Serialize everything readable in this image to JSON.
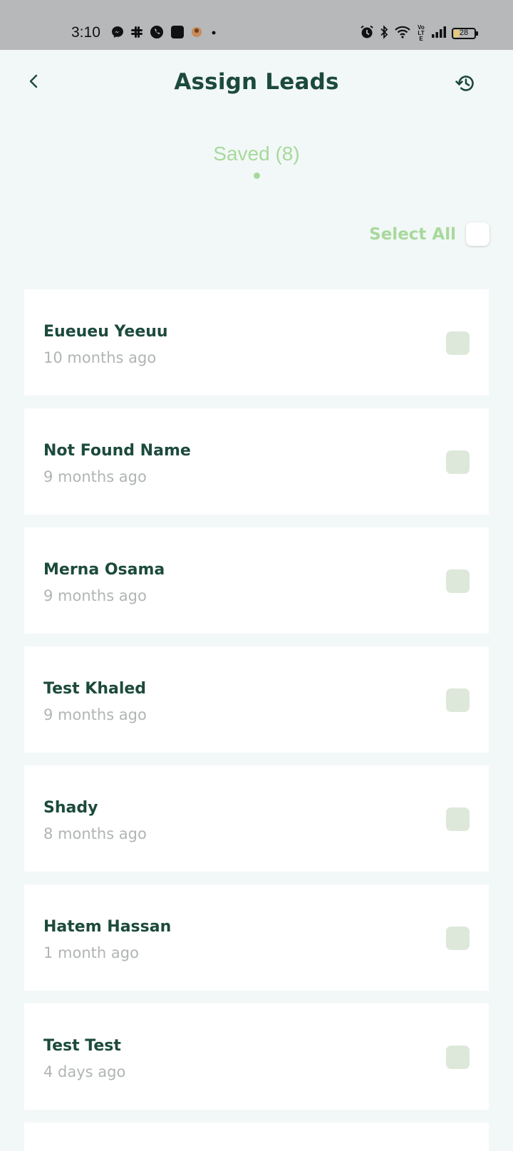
{
  "status_bar": {
    "time": "3:10",
    "battery_level": "28",
    "battery_fraction": 0.28,
    "lte_label": "Vo LTE",
    "left_icons": [
      "messenger-icon",
      "slack-icon",
      "whatsapp-icon",
      "square-app-icon",
      "avatar-icon",
      "dot-icon"
    ],
    "right_icons": [
      "alarm-icon",
      "bluetooth-icon",
      "wifi-icon",
      "volte-icon",
      "signal-icon",
      "battery-icon"
    ]
  },
  "header": {
    "title": "Assign Leads",
    "back_icon": "chevron-left-icon",
    "history_icon": "history-icon"
  },
  "tabs": [
    {
      "label": "Saved (8)",
      "active": true
    }
  ],
  "select_all": {
    "label": "Select All",
    "checked": false
  },
  "leads": [
    {
      "name": "Eueueu Yeeuu",
      "time": "10 months ago",
      "checked": false
    },
    {
      "name": "Not Found Name",
      "time": "9 months ago",
      "checked": false
    },
    {
      "name": "Merna Osama",
      "time": "9 months ago",
      "checked": false
    },
    {
      "name": "Test Khaled",
      "time": "9 months ago",
      "checked": false
    },
    {
      "name": "Shady",
      "time": "8 months ago",
      "checked": false
    },
    {
      "name": "Hatem Hassan",
      "time": "1 month ago",
      "checked": false
    },
    {
      "name": "Test Test",
      "time": "4 days ago",
      "checked": false
    }
  ],
  "colors": {
    "background": "#f2f8f7",
    "primary_dark": "#1c4a3c",
    "accent_green": "#a8d99c",
    "muted_text": "#b0b5b3",
    "checkbox_fill": "#dde8da",
    "status_bar": "#b6b8b9"
  }
}
